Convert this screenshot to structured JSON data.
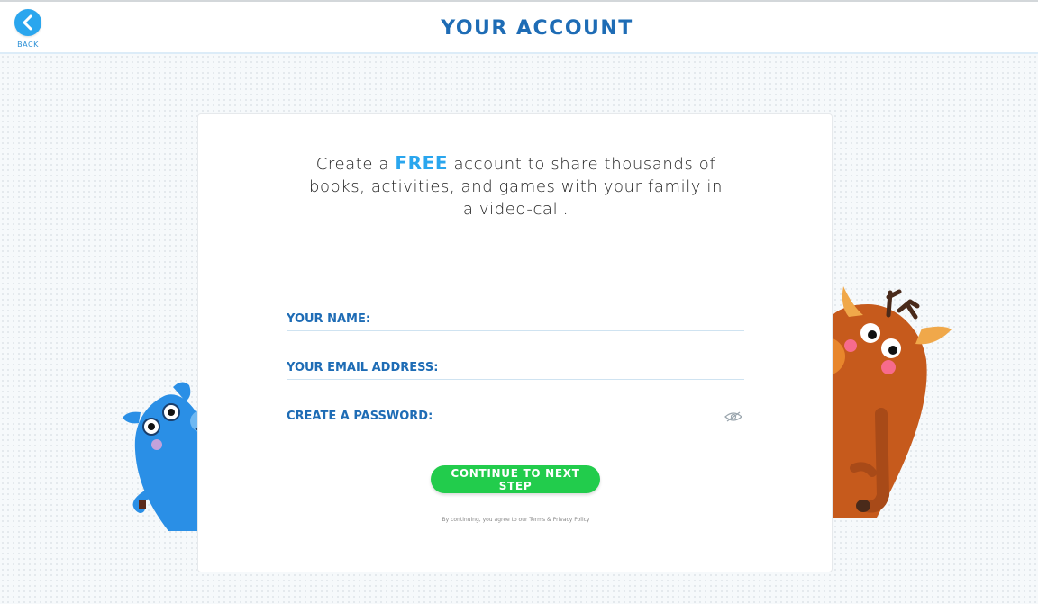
{
  "header": {
    "title": "YOUR ACCOUNT",
    "back_label": "BACK"
  },
  "card": {
    "intro_before": "Create a ",
    "intro_highlight": "FREE",
    "intro_after": " account to share thousands of books, activities, and games with your family in a video-call."
  },
  "form": {
    "name_placeholder": "YOUR NAME:",
    "email_placeholder": "YOUR EMAIL ADDRESS:",
    "password_placeholder": "CREATE A PASSWORD:",
    "continue_label": "CONTINUE TO NEXT STEP"
  },
  "terms": {
    "prefix": "By continuing, you agree to our ",
    "terms_link": "Terms",
    "separator": " & ",
    "privacy_link": "Privacy Policy"
  },
  "icons": {
    "back": "chevron-left-icon",
    "password_toggle": "eye-slash-icon"
  },
  "colors": {
    "title": "#1e6cb5",
    "accent": "#2aa6ee",
    "button": "#22cc4c"
  }
}
